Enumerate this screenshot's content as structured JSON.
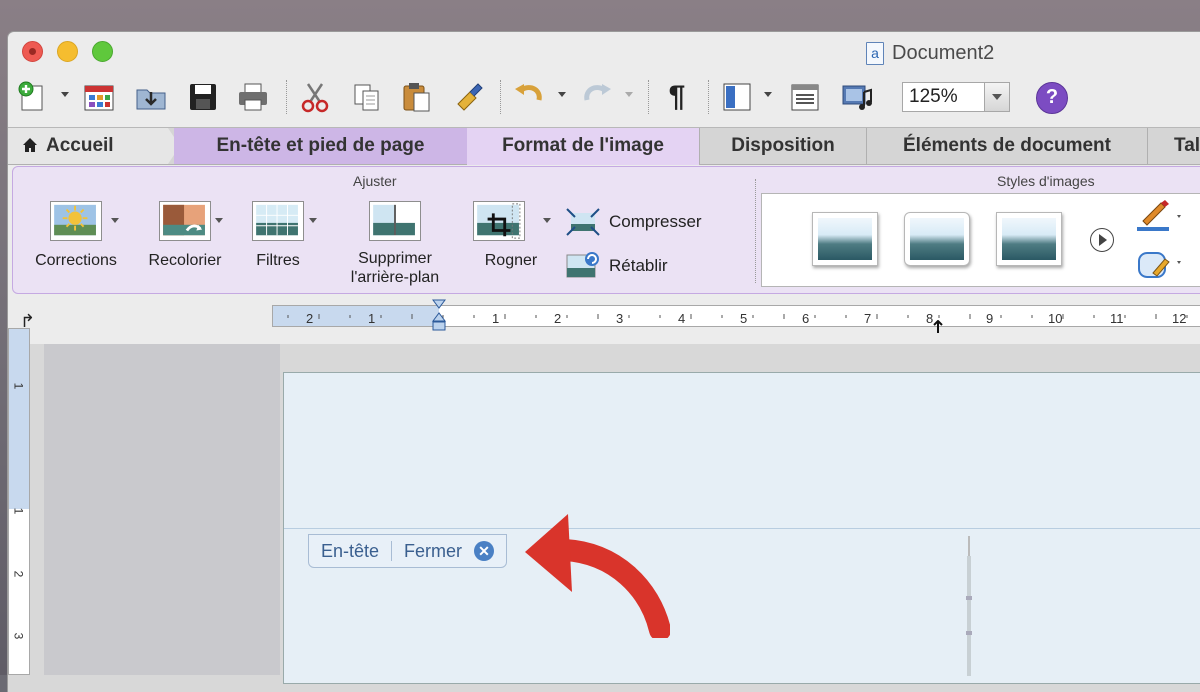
{
  "window": {
    "title": "Document2",
    "doc_icon_glyph": "a"
  },
  "toolbar": {
    "zoom": "125%",
    "help_glyph": "?",
    "pilcrow": "¶",
    "icons": [
      "new-document-icon",
      "gallery-icon",
      "open-icon",
      "save-icon",
      "print-icon",
      "cut-icon",
      "copy-icon",
      "paste-icon",
      "format-painter-icon",
      "undo-icon",
      "redo-icon",
      "pilcrow-icon",
      "sidebar-icon",
      "view-icon",
      "media-browser-icon",
      "zoom-select",
      "help-icon"
    ]
  },
  "tabs": {
    "home": "Accueil",
    "header_footer": "En-tête et pied de page",
    "picture_format": "Format de l'image",
    "layout": "Disposition",
    "document_elements": "Éléments de document",
    "more": "Tal"
  },
  "ribbon": {
    "group_adjust": "Ajuster",
    "group_styles": "Styles d'images",
    "corrections": "Corrections",
    "recolor": "Recolorier",
    "filters": "Filtres",
    "remove_bg_line1": "Supprimer",
    "remove_bg_line2": "l'arrière-plan",
    "crop": "Rogner",
    "compress": "Compresser",
    "reset": "Rétablir"
  },
  "ruler": {
    "labels": [
      "2",
      "1",
      "1",
      "2",
      "3",
      "4",
      "5",
      "6",
      "7",
      "8",
      "9",
      "10",
      "11",
      "12"
    ],
    "vertical_labels": [
      "1",
      "1",
      "2",
      "3"
    ],
    "tab_selector": "↱"
  },
  "header_tag": {
    "label": "En-tête",
    "close": "Fermer",
    "close_glyph": "✕"
  },
  "colors": {
    "accent_purple": "#cdb6e6",
    "ribbon_bg": "#ebe2f4",
    "arrow_red": "#d9342b",
    "header_blue": "#3a5f8f"
  }
}
